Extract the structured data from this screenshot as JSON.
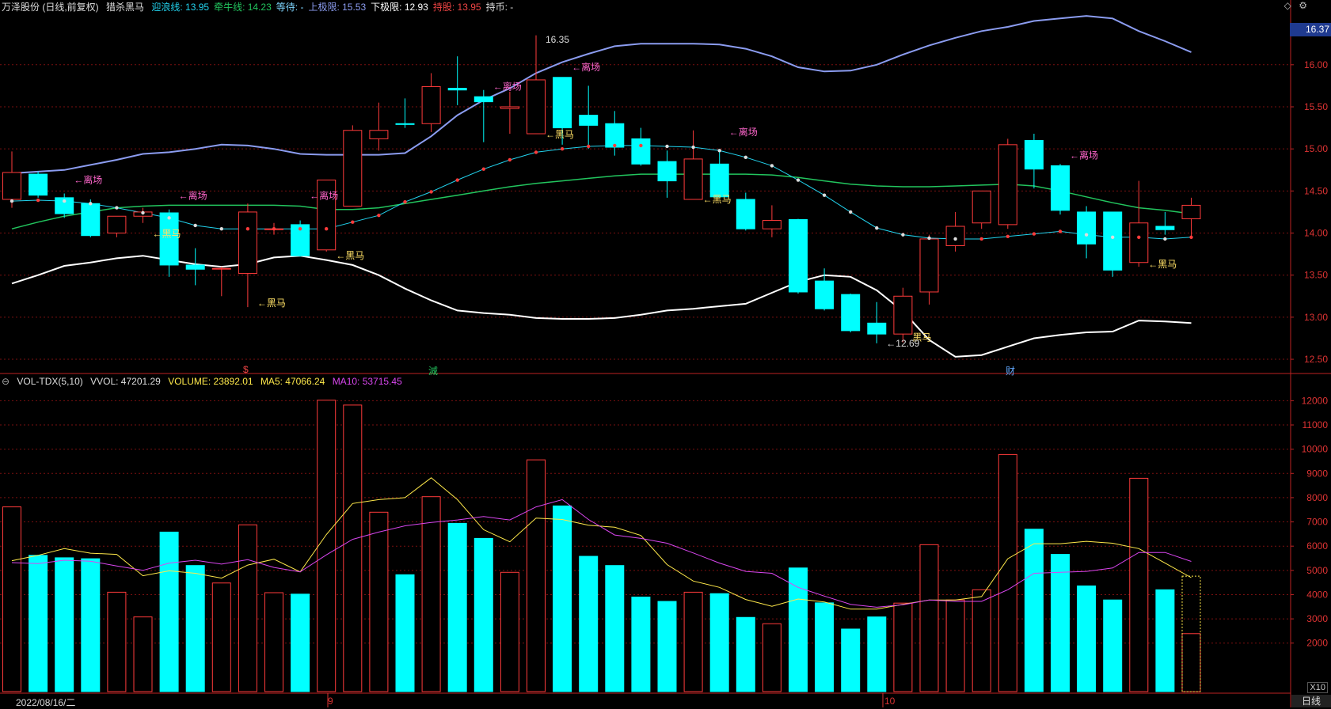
{
  "header": {
    "title": "万泽股份 (日线,前复权)",
    "indicator": "猎杀黑马",
    "fields": [
      {
        "label": "迎浪线:",
        "value": "13.95",
        "color": "#22d3ee"
      },
      {
        "label": "牵牛线:",
        "value": "14.23",
        "color": "#22c55e"
      },
      {
        "label": "等待:",
        "value": "-",
        "color": "#7dd3fc"
      },
      {
        "label": "上极限:",
        "value": "15.53",
        "color": "#8b9cf0"
      },
      {
        "label": "下极限:",
        "value": "12.93",
        "color": "#ffffff"
      },
      {
        "label": "持股:",
        "value": "13.95",
        "color": "#ef4444"
      },
      {
        "label": "持币:",
        "value": "-",
        "color": "#dddddd"
      }
    ],
    "icons": [
      "diamond-icon",
      "settings-icon"
    ]
  },
  "vol_header": {
    "name": "VOL-TDX(5,10)",
    "vvol": "VVOL: 47201.29",
    "volume": "VOLUME: 23892.01",
    "ma5": "MA5: 47066.24",
    "ma10": "MA10: 53715.45"
  },
  "price_badge": "16.37",
  "x10": "X10",
  "period": "日线",
  "date_label": "2022/08/16/二",
  "month_marks": [
    "9",
    "10"
  ],
  "events": [
    {
      "text": "$",
      "color": "#ef4444"
    },
    {
      "text": "減",
      "color": "#22c55e"
    },
    {
      "text": "财",
      "color": "#60a5fa"
    }
  ],
  "chart_data": [
    {
      "type": "candlestick",
      "title": "万泽股份 (日线,前复权)",
      "ylim": [
        12.35,
        16.6
      ],
      "y_ticks": [
        12.5,
        13.0,
        13.5,
        14.0,
        14.5,
        15.0,
        15.5,
        16.0
      ],
      "y_tick_labels": [
        "12.50",
        "13.00",
        "13.50",
        "14.00",
        "14.50",
        "15.00",
        "15.50",
        "16.00"
      ],
      "candles": [
        {
          "o": 14.4,
          "h": 14.97,
          "l": 14.3,
          "c": 14.72
        },
        {
          "o": 14.7,
          "h": 14.73,
          "l": 14.42,
          "c": 14.45
        },
        {
          "o": 14.42,
          "h": 14.47,
          "l": 14.18,
          "c": 14.23
        },
        {
          "o": 14.35,
          "h": 14.4,
          "l": 13.95,
          "c": 13.97
        },
        {
          "o": 14.0,
          "h": 14.2,
          "l": 13.95,
          "c": 14.2
        },
        {
          "o": 14.2,
          "h": 14.3,
          "l": 14.12,
          "c": 14.25
        },
        {
          "o": 14.24,
          "h": 14.28,
          "l": 13.48,
          "c": 13.62
        },
        {
          "o": 13.62,
          "h": 13.82,
          "l": 13.38,
          "c": 13.57
        },
        {
          "o": 13.58,
          "h": 13.6,
          "l": 13.25,
          "c": 13.58
        },
        {
          "o": 13.52,
          "h": 14.35,
          "l": 13.12,
          "c": 14.25
        },
        {
          "o": 14.04,
          "h": 14.12,
          "l": 13.98,
          "c": 14.05
        },
        {
          "o": 14.1,
          "h": 14.15,
          "l": 13.72,
          "c": 13.73
        },
        {
          "o": 13.8,
          "h": 14.33,
          "l": 13.78,
          "c": 14.63
        },
        {
          "o": 14.32,
          "h": 15.28,
          "l": 14.35,
          "c": 15.22
        },
        {
          "o": 15.12,
          "h": 15.55,
          "l": 14.98,
          "c": 15.22
        },
        {
          "o": 15.3,
          "h": 15.6,
          "l": 15.25,
          "c": 15.29
        },
        {
          "o": 15.3,
          "h": 15.9,
          "l": 15.2,
          "c": 15.74
        },
        {
          "o": 15.72,
          "h": 16.1,
          "l": 15.52,
          "c": 15.7
        },
        {
          "o": 15.62,
          "h": 15.7,
          "l": 15.08,
          "c": 15.56
        },
        {
          "o": 15.48,
          "h": 15.68,
          "l": 15.18,
          "c": 15.5
        },
        {
          "o": 15.18,
          "h": 16.35,
          "l": 15.2,
          "c": 15.82
        },
        {
          "o": 15.85,
          "h": 15.82,
          "l": 15.05,
          "c": 15.25
        },
        {
          "o": 15.4,
          "h": 15.75,
          "l": 15.0,
          "c": 15.28
        },
        {
          "o": 15.3,
          "h": 15.45,
          "l": 14.92,
          "c": 15.02
        },
        {
          "o": 15.12,
          "h": 15.25,
          "l": 14.8,
          "c": 14.82
        },
        {
          "o": 14.85,
          "h": 14.98,
          "l": 14.42,
          "c": 14.62
        },
        {
          "o": 14.4,
          "h": 15.22,
          "l": 14.4,
          "c": 14.88
        },
        {
          "o": 14.82,
          "h": 14.98,
          "l": 14.42,
          "c": 14.43
        },
        {
          "o": 14.4,
          "h": 14.48,
          "l": 14.03,
          "c": 14.05
        },
        {
          "o": 14.05,
          "h": 14.33,
          "l": 13.95,
          "c": 14.15
        },
        {
          "o": 14.16,
          "h": 14.17,
          "l": 13.28,
          "c": 13.3
        },
        {
          "o": 13.43,
          "h": 13.58,
          "l": 13.08,
          "c": 13.1
        },
        {
          "o": 13.27,
          "h": 13.28,
          "l": 12.82,
          "c": 12.84
        },
        {
          "o": 12.93,
          "h": 13.18,
          "l": 12.69,
          "c": 12.8
        },
        {
          "o": 12.8,
          "h": 13.35,
          "l": 12.7,
          "c": 13.25
        },
        {
          "o": 13.3,
          "h": 13.98,
          "l": 13.15,
          "c": 13.93
        },
        {
          "o": 13.85,
          "h": 14.25,
          "l": 13.78,
          "c": 14.08
        },
        {
          "o": 14.12,
          "h": 14.5,
          "l": 14.05,
          "c": 14.5
        },
        {
          "o": 14.1,
          "h": 15.12,
          "l": 14.05,
          "c": 15.05
        },
        {
          "o": 15.1,
          "h": 15.18,
          "l": 14.53,
          "c": 14.76
        },
        {
          "o": 14.8,
          "h": 14.82,
          "l": 14.22,
          "c": 14.27
        },
        {
          "o": 14.25,
          "h": 14.32,
          "l": 13.7,
          "c": 13.87
        },
        {
          "o": 14.25,
          "h": 14.22,
          "l": 13.48,
          "c": 13.56
        },
        {
          "o": 13.65,
          "h": 14.62,
          "l": 13.6,
          "c": 14.12
        },
        {
          "o": 14.08,
          "h": 14.25,
          "l": 13.98,
          "c": 14.04
        },
        {
          "o": 14.17,
          "h": 14.42,
          "l": 13.93,
          "c": 14.33
        }
      ],
      "upper_limit": [
        14.71,
        14.73,
        14.75,
        14.81,
        14.87,
        14.94,
        14.96,
        15.0,
        15.05,
        15.04,
        15.0,
        14.94,
        14.93,
        14.93,
        14.93,
        14.95,
        15.15,
        15.4,
        15.58,
        15.72,
        15.9,
        16.03,
        16.13,
        16.22,
        16.25,
        16.25,
        16.25,
        16.24,
        16.19,
        16.1,
        15.97,
        15.92,
        15.93,
        16.0,
        16.12,
        16.23,
        16.32,
        16.4,
        16.45,
        16.52,
        16.55,
        16.58,
        16.55,
        16.4,
        16.28,
        16.15
      ],
      "lower_limit": [
        13.4,
        13.5,
        13.61,
        13.65,
        13.7,
        13.73,
        13.68,
        13.63,
        13.6,
        13.63,
        13.71,
        13.73,
        13.68,
        13.62,
        13.5,
        13.34,
        13.2,
        13.08,
        13.05,
        13.03,
        12.99,
        12.98,
        12.98,
        12.99,
        13.03,
        13.08,
        13.1,
        13.13,
        13.16,
        13.29,
        13.42,
        13.5,
        13.48,
        13.32,
        13.07,
        12.73,
        12.53,
        12.55,
        12.65,
        12.75,
        12.79,
        12.82,
        12.83,
        12.96,
        12.95,
        12.93
      ],
      "wave_line": [
        14.38,
        14.39,
        14.38,
        14.35,
        14.3,
        14.24,
        14.18,
        14.09,
        14.05,
        14.05,
        14.05,
        14.05,
        14.05,
        14.13,
        14.21,
        14.37,
        14.49,
        14.63,
        14.76,
        14.87,
        14.96,
        15.0,
        15.03,
        15.04,
        15.04,
        15.03,
        15.02,
        14.98,
        14.9,
        14.8,
        14.63,
        14.45,
        14.25,
        14.06,
        13.98,
        13.94,
        13.93,
        13.93,
        13.96,
        13.99,
        14.02,
        13.98,
        13.95,
        13.95,
        13.93,
        13.95
      ],
      "ox_line": [
        14.05,
        14.13,
        14.2,
        14.25,
        14.3,
        14.32,
        14.33,
        14.33,
        14.33,
        14.33,
        14.33,
        14.32,
        14.28,
        14.28,
        14.3,
        14.35,
        14.4,
        14.45,
        14.5,
        14.55,
        14.59,
        14.62,
        14.65,
        14.68,
        14.7,
        14.7,
        14.7,
        14.7,
        14.7,
        14.69,
        14.66,
        14.62,
        14.58,
        14.56,
        14.55,
        14.55,
        14.56,
        14.57,
        14.58,
        14.56,
        14.5,
        14.43,
        14.36,
        14.3,
        14.27,
        14.23
      ],
      "labels": [
        {
          "i": 2,
          "text": "←离场",
          "price": 14.63,
          "color": "#ff66cc"
        },
        {
          "i": 6,
          "text": "←离场",
          "price": 14.44,
          "color": "#ff66cc"
        },
        {
          "i": 11,
          "text": "←离场",
          "price": 14.44,
          "color": "#ff66cc"
        },
        {
          "i": 18,
          "text": "←离场",
          "price": 15.74,
          "color": "#ff66cc"
        },
        {
          "i": 21,
          "text": "←离场",
          "price": 15.97,
          "color": "#ff66cc"
        },
        {
          "i": 27,
          "text": "←离场",
          "price": 15.2,
          "color": "#ff66cc"
        },
        {
          "i": 40,
          "text": "←离场",
          "price": 14.92,
          "color": "#ff66cc"
        },
        {
          "i": 5,
          "text": "←黑马",
          "price": 13.99,
          "color": "#ffe066"
        },
        {
          "i": 9,
          "text": "←黑马",
          "price": 13.17,
          "color": "#ffe066"
        },
        {
          "i": 12,
          "text": "←黑马",
          "price": 13.73,
          "color": "#ffe066"
        },
        {
          "i": 20,
          "text": "←黑马",
          "price": 15.17,
          "color": "#ffe066"
        },
        {
          "i": 26,
          "text": "←黑马",
          "price": 14.4,
          "color": "#ffe066"
        },
        {
          "i": 34,
          "text": "黑马",
          "price": 12.76,
          "color": "#ffe066"
        },
        {
          "i": 43,
          "text": "←黑马",
          "price": 13.63,
          "color": "#ffe066"
        },
        {
          "i": 20,
          "text": "16.35",
          "price": 16.3,
          "color": "#dddddd"
        },
        {
          "i": 33,
          "text": "←12.69",
          "price": 12.69,
          "color": "#dddddd"
        }
      ]
    },
    {
      "type": "bar",
      "title": "VOL-TDX(5,10)",
      "ylim": [
        0,
        12600
      ],
      "y_ticks": [
        2000,
        3000,
        4000,
        5000,
        6000,
        7000,
        8000,
        9000,
        10000,
        11000,
        12000
      ],
      "y_tick_labels": [
        "2000",
        "3000",
        "4000",
        "5000",
        "6000",
        "7000",
        "8000",
        "9000",
        "10000",
        "11000",
        "12000"
      ],
      "unit": "X10",
      "volumes": [
        7620,
        5620,
        5520,
        5480,
        4100,
        3080,
        6580,
        5200,
        4480,
        6880,
        4080,
        4020,
        12020,
        11820,
        7400,
        4820,
        8040,
        6940,
        6320,
        4920,
        9560,
        7660,
        5580,
        5200,
        3900,
        3720,
        4100,
        4040,
        3060,
        2800,
        5100,
        3660,
        2580,
        3080,
        3650,
        6060,
        3780,
        4200,
        9780,
        6700,
        5660,
        4360,
        3780,
        8800,
        4200,
        2390
      ],
      "ma5": [
        5400,
        5620,
        5900,
        5710,
        5660,
        4780,
        4980,
        4880,
        4680,
        5220,
        5460,
        4940,
        6480,
        7760,
        7920,
        8000,
        8820,
        7920,
        6680,
        6180,
        7160,
        7100,
        6860,
        6780,
        6440,
        5240,
        4560,
        4300,
        3800,
        3520,
        3820,
        3700,
        3400,
        3400,
        3600,
        3780,
        3780,
        3920,
        5480,
        6100,
        6100,
        6200,
        6120,
        5900,
        5300,
        4700
      ],
      "ma10": [
        5320,
        5280,
        5420,
        5380,
        5180,
        5000,
        5300,
        5420,
        5260,
        5440,
        5120,
        4940,
        5640,
        6280,
        6580,
        6840,
        6980,
        7080,
        7220,
        7080,
        7620,
        7920,
        7100,
        6460,
        6320,
        6120,
        5720,
        5300,
        4960,
        4880,
        4300,
        3940,
        3600,
        3480,
        3580,
        3780,
        3720,
        3720,
        4200,
        4880,
        4920,
        4960,
        5100,
        5740,
        5740,
        5370
      ],
      "current_volume_outline": 4760
    }
  ]
}
